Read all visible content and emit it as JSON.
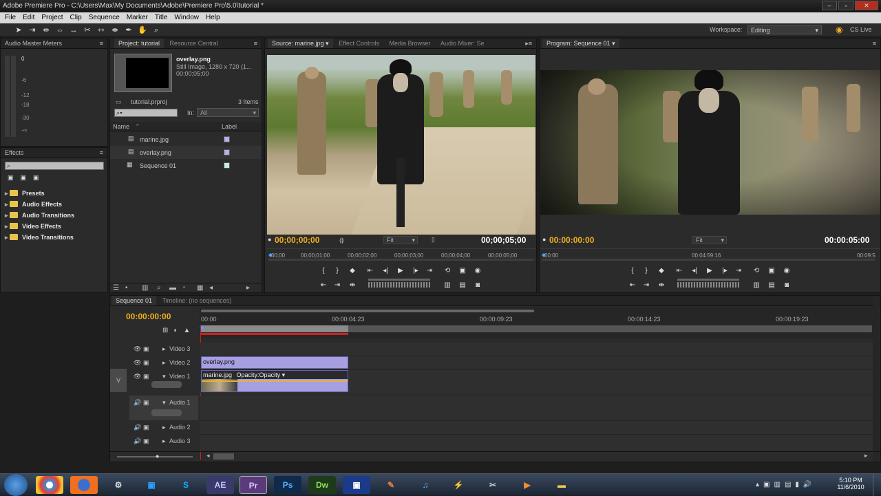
{
  "window": {
    "title": "Adobe Premiere Pro - C:\\Users\\Max\\My Documents\\Adobe\\Premiere Pro\\5.0\\tutorial *"
  },
  "menu": [
    "File",
    "Edit",
    "Project",
    "Clip",
    "Sequence",
    "Marker",
    "Title",
    "Window",
    "Help"
  ],
  "workspace": {
    "label": "Workspace:",
    "value": "Editing",
    "cslive": "CS Live"
  },
  "audio_meters": {
    "tab": "Audio Master Meters",
    "scale": [
      "0",
      "-6",
      "-12",
      "-18",
      "-30",
      "-∞"
    ]
  },
  "project": {
    "tab": "Project: tutorial",
    "tab2": "Resource Central",
    "preview_name": "overlay.png",
    "preview_info1": "Still Image, 1280 x 720 (1...",
    "preview_info2": "00;00;05;00",
    "proj_file": "tutorial.prproj",
    "items_count": "3 Items",
    "in_label": "In:",
    "in_value": "All",
    "col_name": "Name",
    "col_label": "Label",
    "items": [
      {
        "name": "marine.jpg",
        "color": "#b7aee6"
      },
      {
        "name": "overlay.png",
        "color": "#b7aee6"
      },
      {
        "name": "Sequence 01",
        "color": "#c9ece0"
      }
    ]
  },
  "effects": {
    "tab": "Effects",
    "folders": [
      "Presets",
      "Audio Effects",
      "Audio Transitions",
      "Video Effects",
      "Video Transitions"
    ]
  },
  "source": {
    "tabs": [
      "Source: marine.jpg",
      "Effect Controls",
      "Media Browser",
      "Audio Mixer: Se"
    ],
    "tc_left": "00;00;00;00",
    "fit": "Fit",
    "tc_right": "00;00;05;00",
    "ruler": [
      "00;00",
      "00;00;01;00",
      "00;00;02;00",
      "00;00;03;00",
      "00;00;04;00",
      "00;00;05;00"
    ]
  },
  "program": {
    "tab": "Program: Sequence 01",
    "tc_left": "00:00:00:00",
    "fit": "Fit",
    "tc_right": "00:00:05:00",
    "ruler": [
      "00:00",
      "00:04:59:16",
      "00:09:5"
    ]
  },
  "timeline": {
    "tabs": [
      "Sequence 01",
      "Timeline: (no sequences)"
    ],
    "timecode": "00:00:00:00",
    "ruler": [
      "00:00",
      "00:00:04:23",
      "00:00:09:23",
      "00:00:14:23",
      "00:00:19:23"
    ],
    "tracks": {
      "video3": "Video 3",
      "video2": "Video 2",
      "video1": "Video 1",
      "audio1": "Audio 1",
      "audio2": "Audio 2",
      "audio3": "Audio 3",
      "v": "V"
    },
    "clips": {
      "overlay": "overlay.png",
      "marine": "marine.jpg",
      "opacity": "Opacity:Opacity ▾"
    }
  },
  "taskbar": {
    "time": "5:10 PM",
    "date": "11/6/2010",
    "apps": [
      "AE",
      "Pr",
      "Ps",
      "Dw"
    ]
  }
}
